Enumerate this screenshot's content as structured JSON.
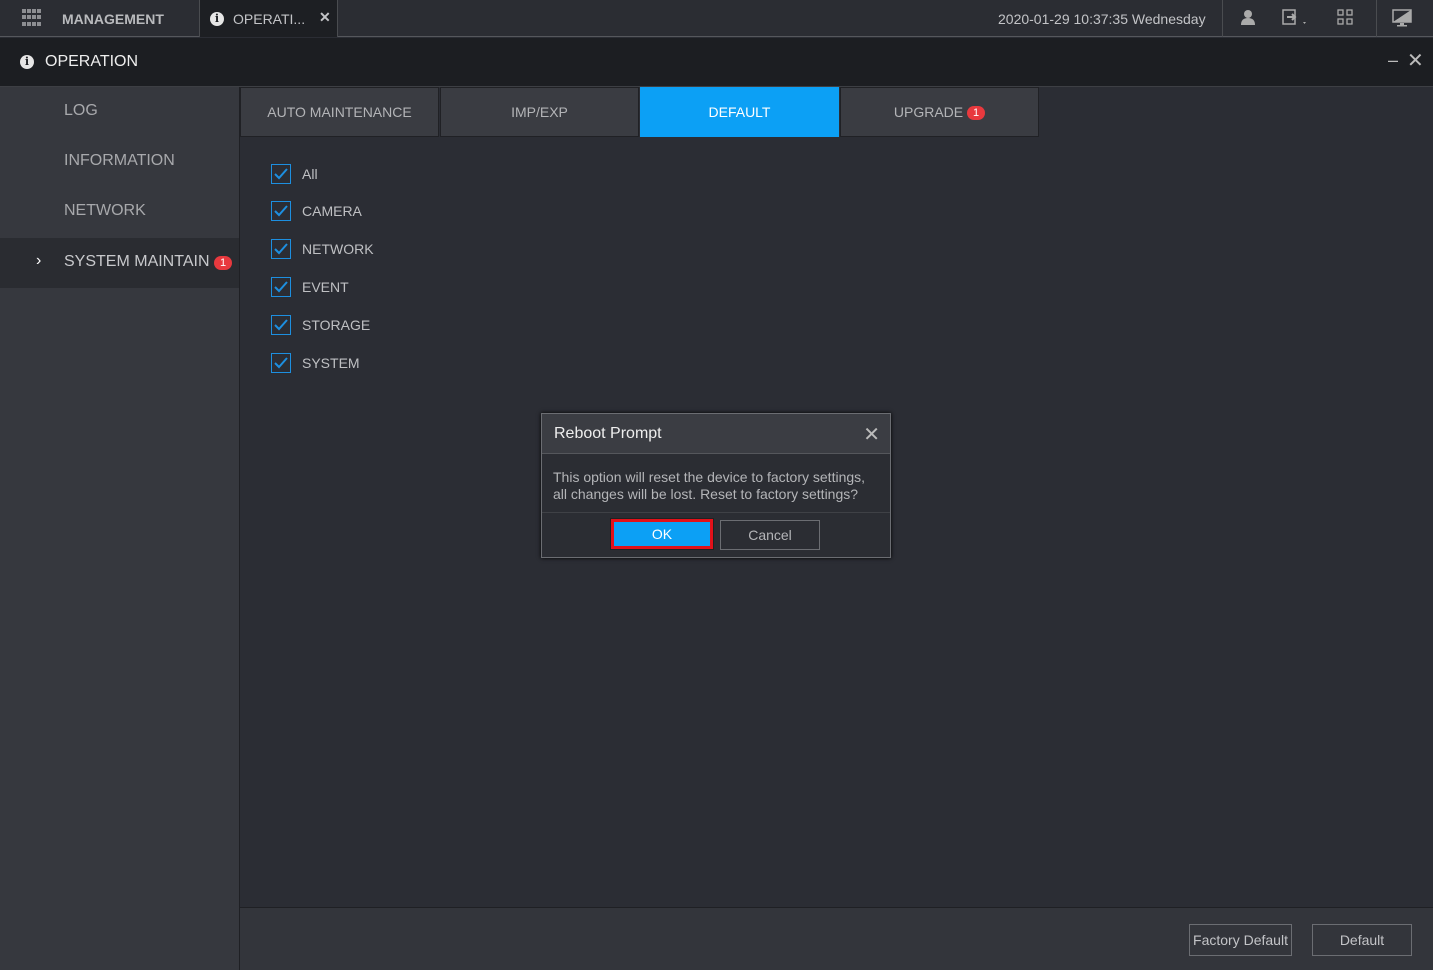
{
  "topbar": {
    "management_label": "MANAGEMENT",
    "open_tab_label": "OPERATI...",
    "datetime": "2020-01-29 10:37:35 Wednesday"
  },
  "titlebar": {
    "title": "OPERATION"
  },
  "sidebar": {
    "items": [
      {
        "label": "LOG"
      },
      {
        "label": "INFORMATION"
      },
      {
        "label": "NETWORK"
      },
      {
        "label": "SYSTEM MAINTAIN",
        "badge": "1"
      }
    ]
  },
  "tabs": [
    {
      "label": "AUTO MAINTENANCE"
    },
    {
      "label": "IMP/EXP"
    },
    {
      "label": "DEFAULT"
    },
    {
      "label": "UPGRADE",
      "badge": "1"
    }
  ],
  "checkboxes": [
    {
      "label": "All",
      "checked": true
    },
    {
      "label": "CAMERA",
      "checked": true
    },
    {
      "label": "NETWORK",
      "checked": true
    },
    {
      "label": "EVENT",
      "checked": true
    },
    {
      "label": "STORAGE",
      "checked": true
    },
    {
      "label": "SYSTEM",
      "checked": true
    }
  ],
  "dialog": {
    "title": "Reboot Prompt",
    "message_line1": "This option will reset the device to factory settings,",
    "message_line2": "all changes will be lost. Reset to factory settings?",
    "ok_label": "OK",
    "cancel_label": "Cancel"
  },
  "footer": {
    "factory_default_label": "Factory Default",
    "default_label": "Default"
  },
  "colors": {
    "accent": "#0ca0f5",
    "badge": "#e8393e",
    "highlight": "#e3111a"
  }
}
